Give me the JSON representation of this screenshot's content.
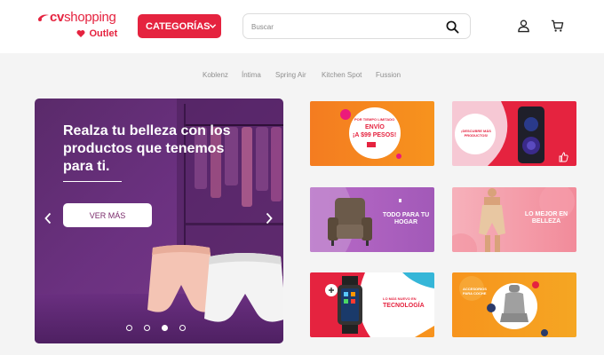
{
  "header": {
    "logo": {
      "brand_main": "cv",
      "brand_rest": "shopping",
      "sub": "Outlet"
    },
    "categories_button": "CATEGORÍAS",
    "search": {
      "placeholder": "Buscar"
    },
    "icons": [
      "user-icon",
      "cart-icon",
      "search-icon",
      "chevron-down-icon"
    ]
  },
  "brands": [
    "Koblenz",
    "Íntima",
    "Spring Air",
    "Kitchen Spot",
    "Fussion"
  ],
  "hero": {
    "title": "Realza tu belleza con los productos que tenemos para ti.",
    "button": "VER MÁS",
    "slides_total": 4,
    "active_slide": 3
  },
  "tiles": [
    {
      "small": "POR TIEMPO LIMITADO",
      "main_line1": "ENVÍO",
      "main_line2": "¡A $99 PESOS!"
    },
    {
      "small": "¡DESCUBRE MÁS PRODUCTOS!"
    },
    {
      "main": "TODO PARA TU HOGAR"
    },
    {
      "main": "LO MEJOR EN BELLEZA"
    },
    {
      "small": "LO MÁS NUEVO EN",
      "main": "TECNOLOGÍA"
    },
    {
      "small": "ACCESORIOS PARA COCHE"
    }
  ],
  "colors": {
    "brand_red": "#e5233f",
    "hero_purple": "#6b3180",
    "tile_orange": "#f7931e"
  }
}
